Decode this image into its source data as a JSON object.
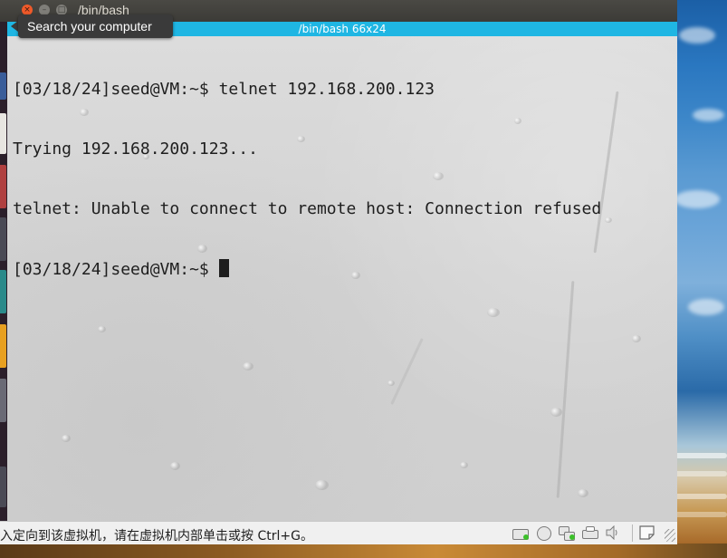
{
  "window": {
    "app_title": "/bin/bash",
    "tab_title": "/bin/bash 66x24"
  },
  "tooltip": {
    "text": "Search your computer"
  },
  "terminal": {
    "lines": [
      "[03/18/24]seed@VM:~$ telnet 192.168.200.123",
      "Trying 192.168.200.123...",
      "telnet: Unable to connect to remote host: Connection refused",
      "[03/18/24]seed@VM:~$ "
    ],
    "header_color": "#1fb6e3"
  },
  "statusbar": {
    "message": "入定向到该虚拟机，请在虚拟机内部单击或按 Ctrl+G。",
    "devices": [
      "hard-disk-icon",
      "cd-rom-icon",
      "network-icon",
      "printer-icon",
      "sound-icon",
      "message-icon"
    ]
  },
  "colors": {
    "titlebar": "#3c3b37",
    "close_button": "#f05a2a",
    "device_led": "#3cc02a"
  }
}
